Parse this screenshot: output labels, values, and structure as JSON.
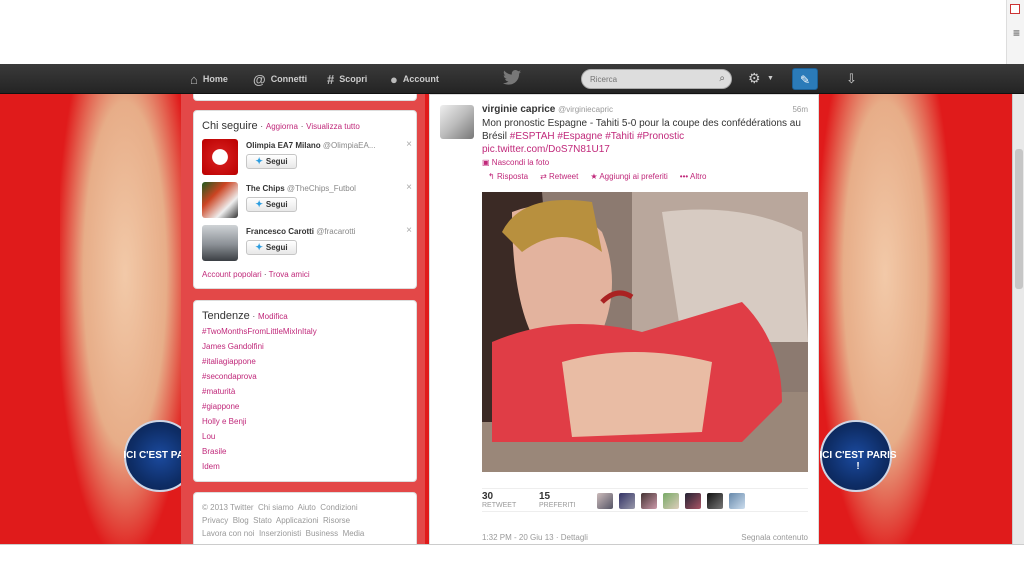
{
  "nav": {
    "home": "Home",
    "connect": "Connetti",
    "discover": "Scopri",
    "account": "Account",
    "search_placeholder": "Ricerca"
  },
  "who_to_follow": {
    "title": "Chi seguire",
    "separator": "·",
    "refresh": "Aggiorna",
    "view_all": "Visualizza tutto",
    "follow_label": "Segui",
    "close_symbol": "×",
    "accounts": [
      {
        "name": "Olimpia EA7 Milano",
        "handle": "@OlimpiaEA..."
      },
      {
        "name": "The Chips",
        "handle": "@TheChips_Futbol"
      },
      {
        "name": "Francesco Carotti",
        "handle": "@fracarotti"
      }
    ],
    "popular_accounts": "Account popolari",
    "find_friends": "Trova amici"
  },
  "trends": {
    "title": "Tendenze",
    "change": "Modifica",
    "items": [
      "#TwoMonthsFromLittleMixInItaly",
      "James Gandolfini",
      "#italiagiappone",
      "#secondaprova",
      "#maturità",
      "#giappone",
      "Holly e Benji",
      "Lou",
      "Brasile",
      "Idem"
    ]
  },
  "footer": {
    "line1": [
      "© 2013 Twitter",
      "Chi siamo",
      "Aiuto",
      "Condizioni"
    ],
    "line2": [
      "Privacy",
      "Blog",
      "Stato",
      "Applicazioni",
      "Risorse"
    ],
    "line3": [
      "Lavora con noi",
      "Inserzionisti",
      "Business",
      "Media"
    ]
  },
  "tweet": {
    "name": "virginie caprice",
    "handle": "@virginiecapric",
    "time": "56m",
    "text_plain": "Mon pronostic Espagne - Tahiti 5-0 pour la coupe des confédérations au Brésil",
    "hashtags": [
      "#ESPTAH",
      "#Espagne",
      "#Tahiti",
      "#Pronostic"
    ],
    "link": "pic.twitter.com/DoS7N81U17",
    "hide_photo": "Nascondi la foto",
    "actions": {
      "reply": "Risposta",
      "retweet": "Retweet",
      "favorite": "Aggiungi ai preferiti",
      "more": "Altro"
    },
    "retweets": "30",
    "retweets_label": "RETWEET",
    "favorites": "15",
    "favorites_label": "PREFERITI",
    "timestamp": "1:32 PM - 20 Giu 13",
    "details": "Dettagli",
    "report": "Segnala contenuto"
  },
  "background": {
    "ball_text_left": "ICI C'EST PARIS",
    "ball_text_right": "ICI C'EST PARIS !",
    "accent": "#e01b1b",
    "link_color": "#c0287a"
  }
}
